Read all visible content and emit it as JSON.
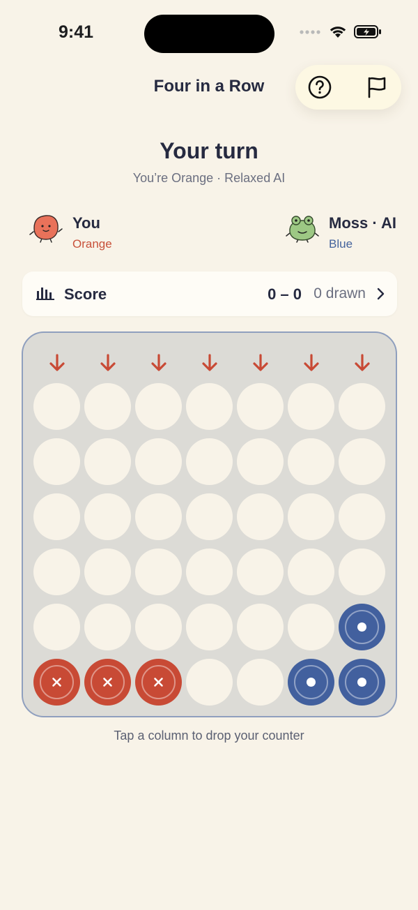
{
  "status_bar": {
    "time": "9:41"
  },
  "header": {
    "title": "Four in a Row",
    "help_icon": "help-circle-icon",
    "flag_icon": "flag-icon"
  },
  "turn": {
    "title": "Your turn",
    "subtitle": "You’re Orange · Relaxed AI"
  },
  "players": {
    "you": {
      "name": "You",
      "color_label": "Orange",
      "avatar": "orange-blob-avatar"
    },
    "ai": {
      "name": "Moss · AI",
      "color_label": "Blue",
      "avatar": "frog-avatar"
    }
  },
  "score": {
    "label": "Score",
    "value": "0 – 0",
    "drawn": "0 drawn",
    "icon": "bar-chart-icon"
  },
  "board": {
    "columns": 7,
    "rows": 6,
    "grid": [
      [
        "",
        "",
        "",
        "",
        "",
        "",
        ""
      ],
      [
        "",
        "",
        "",
        "",
        "",
        "",
        ""
      ],
      [
        "",
        "",
        "",
        "",
        "",
        "",
        ""
      ],
      [
        "",
        "",
        "",
        "",
        "",
        "",
        ""
      ],
      [
        "",
        "",
        "",
        "",
        "",
        "",
        "blue"
      ],
      [
        "red",
        "red",
        "red",
        "",
        "",
        "blue",
        "blue"
      ]
    ]
  },
  "hint": "Tap a column to drop your counter",
  "colors": {
    "orange": "#c84a35",
    "blue": "#42609e",
    "background": "#f8f3e8",
    "board": "#dcdbd6"
  }
}
